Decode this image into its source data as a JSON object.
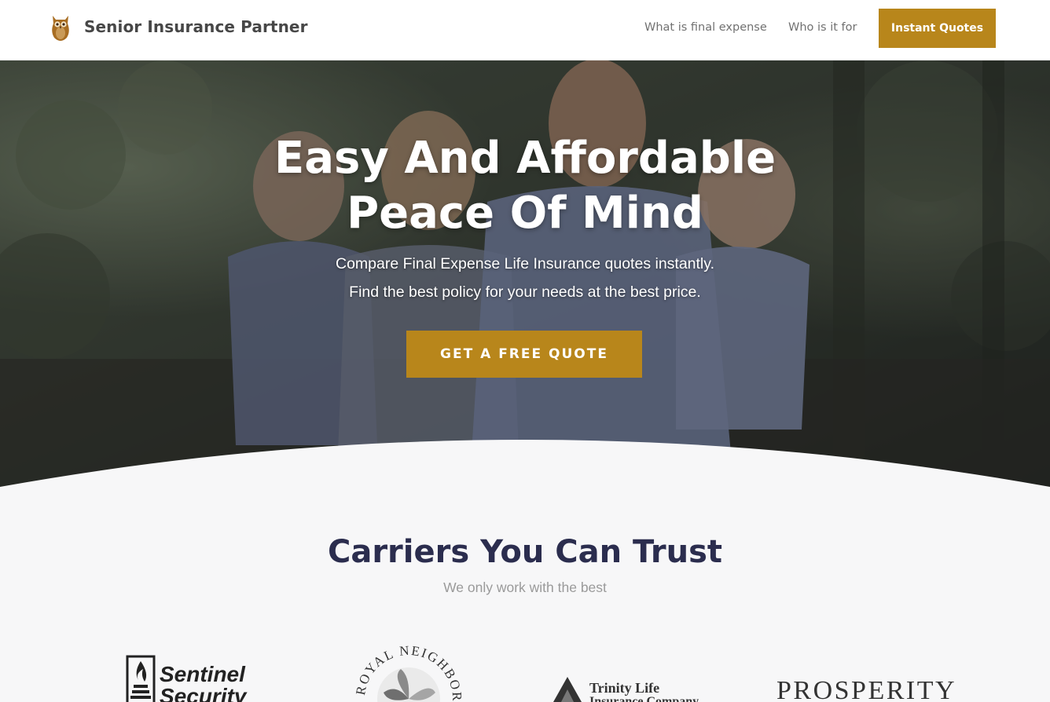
{
  "header": {
    "brand": "Senior Insurance Partner",
    "logo_icon": "owl-icon",
    "nav": [
      {
        "label": "What is final expense"
      },
      {
        "label": "Who is it for"
      }
    ],
    "cta_label": "Instant Quotes"
  },
  "hero": {
    "title_line1": "Easy And Affordable",
    "title_line2": "Peace Of Mind",
    "subtitle_line1": "Compare Final Expense Life Insurance quotes instantly.",
    "subtitle_line2": "Find the best policy for your needs at the best price.",
    "cta_label": "GET A FREE QUOTE"
  },
  "carriers": {
    "title": "Carriers You Can Trust",
    "subtitle": "We only work with the best",
    "logos": [
      {
        "name": "Sentinel Security",
        "line1": "Sentinel",
        "line2": "Security"
      },
      {
        "name": "Royal Neighbors",
        "text": "ROYAL NEIGHBORS"
      },
      {
        "name": "Trinity Life Insurance Company",
        "line1": "Trinity Life",
        "line2": "Insurance Company"
      },
      {
        "name": "Prosperity",
        "text": "PROSPERITY"
      }
    ]
  },
  "colors": {
    "accent": "#b8861b",
    "heading": "#2b2d4e",
    "muted": "#9a9a9a"
  }
}
